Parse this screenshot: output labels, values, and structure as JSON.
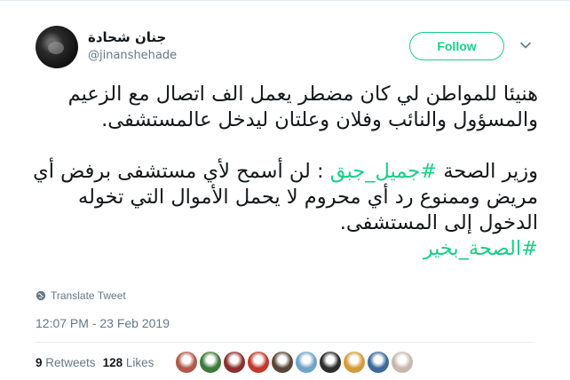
{
  "user": {
    "name": "جنان شحادة",
    "handle": "@jinanshehade"
  },
  "follow_label": "Follow",
  "tweet": {
    "para1_lines": [
      "هنيئا للمواطن لي كان مضطر يعمل الف اتصال مع الزعيم",
      "والمسؤول والنائب وفلان وعلتان ليدخل عالمستشفى."
    ],
    "para2_line1_prefix": "وزير الصحة ",
    "para2_hashtag": "#جميل_جبق",
    "para2_line1_suffix": " : لن أسمح لأي مستشفى برفض أي",
    "para2_lines": [
      "مريض وممنوع رد أي محروم لا يحمل الأموال التي تخوله",
      "الدخول إلى المستشفى."
    ],
    "hashtag2": "#الصحة_بخير"
  },
  "translate_label": "Translate Tweet",
  "timestamp": "12:07 PM - 23 Feb 2019",
  "stats": {
    "retweets_count": "9",
    "retweets_label": "Retweets",
    "likes_count": "128",
    "likes_label": "Likes"
  },
  "likers": [
    {
      "color": "#b0584a"
    },
    {
      "color": "#3d7a3a"
    },
    {
      "color": "#8a2f2f"
    },
    {
      "color": "#c0392b"
    },
    {
      "color": "#5a4636"
    },
    {
      "color": "#6fa3c7"
    },
    {
      "color": "#2c2c2c"
    },
    {
      "color": "#d59a3c"
    },
    {
      "color": "#3b6b9a"
    },
    {
      "color": "#c9b8b0"
    }
  ]
}
